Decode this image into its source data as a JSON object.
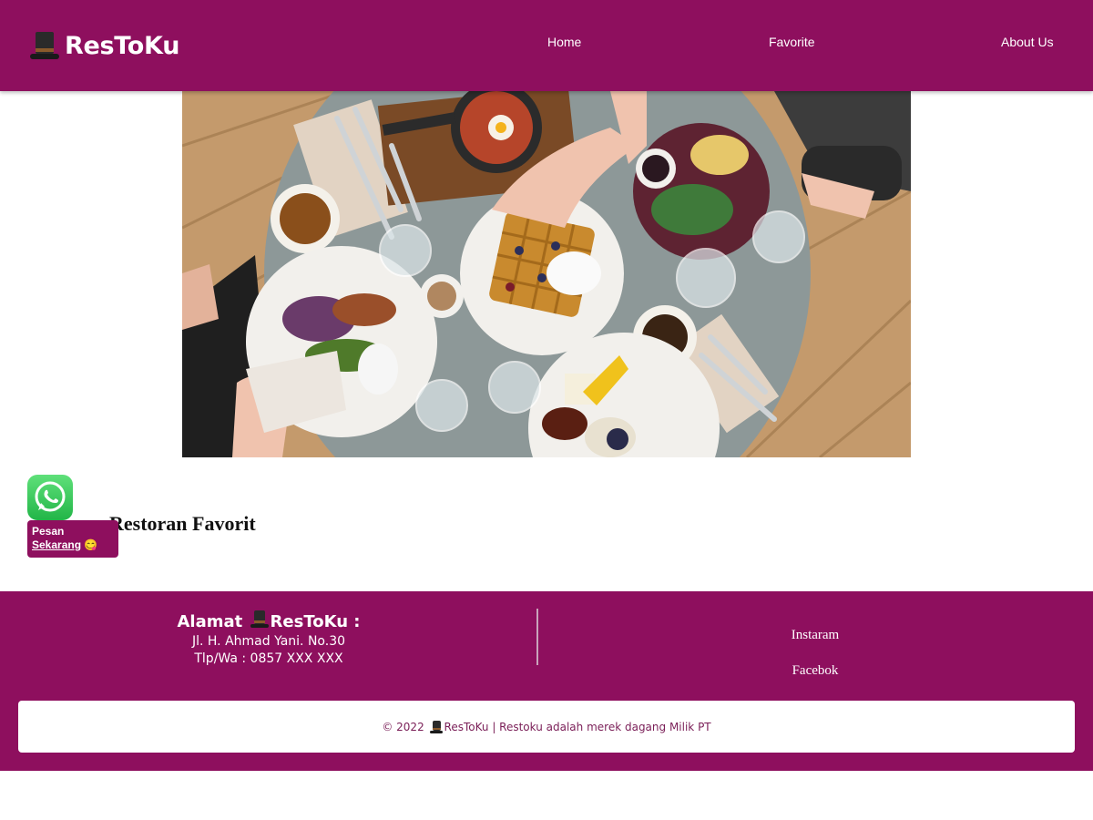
{
  "brand": {
    "name": "ResToKu",
    "icon": "top-hat-icon"
  },
  "nav": [
    {
      "label": "Home"
    },
    {
      "label": "Favorite"
    },
    {
      "label": "About Us"
    }
  ],
  "hero": {
    "icon": "hero-image-food-table"
  },
  "whatsapp": {
    "icon": "whatsapp-icon",
    "line1": "Pesan",
    "line2": "Sekarang",
    "emoji": "😋"
  },
  "main": {
    "title": "Restoran Favorit"
  },
  "footer": {
    "address_title_prefix": "Alamat",
    "address_title_brand": "ResToKu",
    "address_title_suffix": ":",
    "address_line": "Jl. H. Ahmad Yani. No.30",
    "phone_line": "Tlp/Wa : 0857 XXX XXX",
    "social": [
      {
        "label": "Instaram"
      },
      {
        "label": "Facebok"
      }
    ],
    "copyright_prefix": "© 2022",
    "copyright_brand": "ResToKu",
    "copyright_suffix": "| Restoku adalah merek dagang Milik PT"
  },
  "colors": {
    "primary": "#8e0f5e",
    "footer_text": "#7a1e57"
  }
}
